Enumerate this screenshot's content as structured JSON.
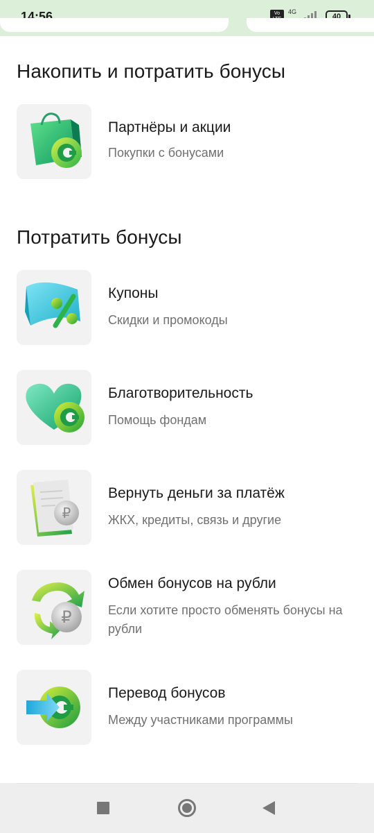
{
  "status_bar": {
    "time": "14:56",
    "volte": "Vo LTE",
    "network": "4G",
    "battery": "40"
  },
  "sections": [
    {
      "title": "Накопить и потратить бонусы",
      "items": [
        {
          "title": "Партнёры и акции",
          "subtitle": "Покупки с бонусами",
          "icon": "shopping-bag-icon"
        }
      ]
    },
    {
      "title": "Потратить бонусы",
      "items": [
        {
          "title": "Купоны",
          "subtitle": "Скидки и промокоды",
          "icon": "coupon-percent-icon"
        },
        {
          "title": "Благотворительность",
          "subtitle": "Помощь фондам",
          "icon": "heart-coin-icon"
        },
        {
          "title": "Вернуть деньги за платёж",
          "subtitle": "ЖКХ, кредиты, связь и другие",
          "icon": "receipt-ruble-icon"
        },
        {
          "title": "Обмен бонусов на рубли",
          "subtitle": "Если хотите просто обменять бонусы на рубли",
          "icon": "exchange-ruble-icon"
        },
        {
          "title": "Перевод бонусов",
          "subtitle": "Между участниками программы",
          "icon": "transfer-bonus-icon"
        }
      ]
    }
  ],
  "nav": {
    "recent_icon": "square-icon",
    "home_icon": "circle-icon",
    "back_icon": "triangle-back-icon"
  },
  "colors": {
    "status_bar_bg": "#dcefd9",
    "brand_green": "#21a038",
    "accent_lime": "#c8e629",
    "subtitle_gray": "#707070"
  }
}
